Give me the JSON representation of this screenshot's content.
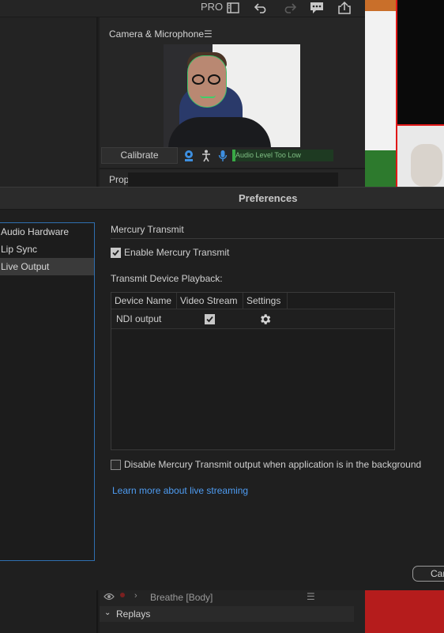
{
  "toolbar": {
    "mode_label": "PRO",
    "icons": [
      "workspace-icon",
      "undo-icon",
      "redo-icon",
      "comment-icon",
      "share-icon"
    ]
  },
  "camera_panel": {
    "title": "Camera & Microphone",
    "menu_icon": "hamburger-menu-icon",
    "calibrate_label": "Calibrate",
    "audio_status": "Audio Level Too Low",
    "prop_label": "Prop"
  },
  "dialog": {
    "title": "Preferences",
    "nav": [
      {
        "label": "Audio Hardware",
        "selected": false
      },
      {
        "label": "Lip Sync",
        "selected": false
      },
      {
        "label": "Live Output",
        "selected": true
      }
    ],
    "section_title": "Mercury Transmit",
    "enable_label": "Enable Mercury Transmit",
    "enable_checked": true,
    "playback_label": "Transmit Device Playback:",
    "table": {
      "headers": [
        "Device Name",
        "Video Stream",
        "Settings"
      ],
      "rows": [
        {
          "device": "NDI output",
          "video_stream": true,
          "settings_icon": "gear-icon"
        }
      ]
    },
    "disable_bg_label": "Disable Mercury Transmit output when application is in the background",
    "disable_bg_checked": false,
    "learn_link": "Learn more about live streaming",
    "cancel_label": "Cancel"
  },
  "timeline": {
    "layer_name": "Breathe [Body]",
    "group_name": "Replays"
  },
  "colors": {
    "accent": "#2f6fb0",
    "link": "#4e9cf2",
    "audio_meter": "#38a845"
  }
}
